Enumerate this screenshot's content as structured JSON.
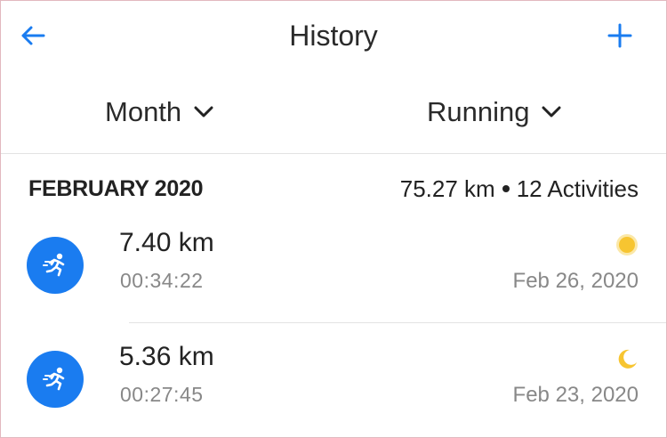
{
  "header": {
    "title": "History",
    "back_icon": "arrow-left-icon",
    "add_icon": "plus-icon",
    "accent": "#1a7cf0"
  },
  "filters": {
    "period": "Month",
    "sport": "Running"
  },
  "summary": {
    "month": "FEBRUARY 2020",
    "distance": "75.27 km",
    "activities": "12 Activities"
  },
  "activities": [
    {
      "distance": "7.40 km",
      "duration": "00:34:22",
      "date": "Feb 26, 2020",
      "time_of_day_icon": "sun-icon",
      "sport_icon": "running-icon"
    },
    {
      "distance": "5.36 km",
      "duration": "00:27:45",
      "date": "Feb 23, 2020",
      "time_of_day_icon": "moon-icon",
      "sport_icon": "running-icon"
    }
  ],
  "colors": {
    "avatar": "#1a7cf0",
    "sun": "#f7c531",
    "moon": "#f7c531"
  }
}
